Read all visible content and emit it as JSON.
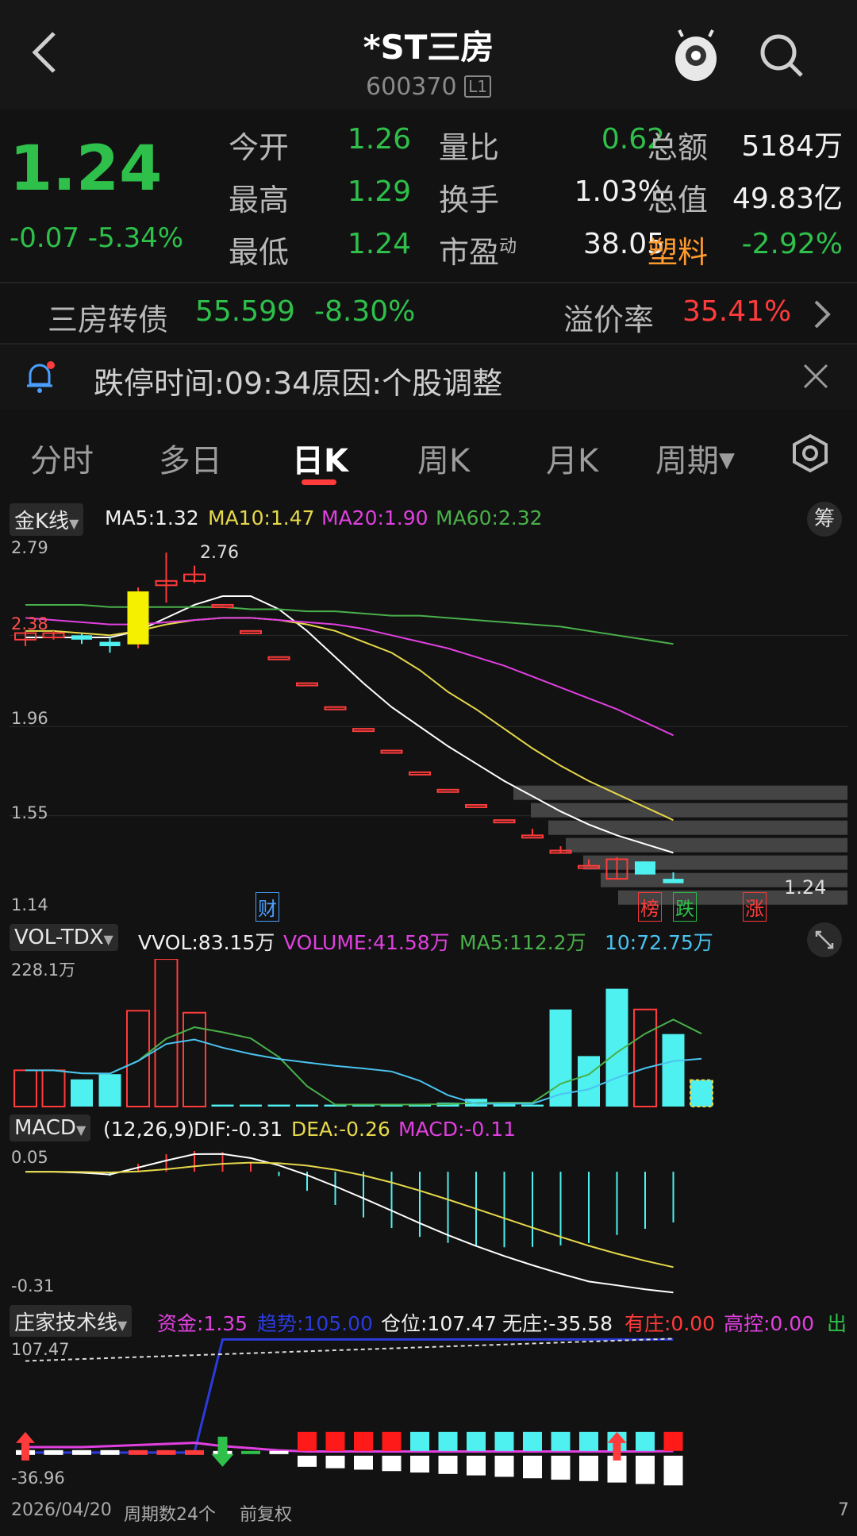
{
  "header": {
    "title": "*ST三房",
    "code": "600370",
    "level_badge": "L1"
  },
  "quote": {
    "price": "1.24",
    "change": "-0.07",
    "change_pct": "-5.34%",
    "stats": [
      {
        "label": "今开",
        "value": "1.26"
      },
      {
        "label": "量比",
        "value": "0.62"
      },
      {
        "label": "总额",
        "value": "5184万"
      },
      {
        "label": "最高",
        "value": "1.29"
      },
      {
        "label": "换手",
        "value": "1.03%"
      },
      {
        "label": "总值",
        "value": "49.83亿"
      },
      {
        "label": "最低",
        "value": "1.24"
      },
      {
        "label": "市盈",
        "sup": "动",
        "value": "38.05"
      },
      {
        "label": "塑料",
        "value": "-2.92%"
      }
    ]
  },
  "bond": {
    "name": "三房转债",
    "price": "55.599",
    "change_pct": "-8.30%",
    "premium_label": "溢价率",
    "premium_value": "35.41%"
  },
  "notice": {
    "text": "跌停时间:09:34原因:个股调整"
  },
  "tabs": {
    "items": [
      "分时",
      "多日",
      "日K",
      "周K",
      "月K",
      "周期"
    ],
    "active": "日K"
  },
  "kline": {
    "selector": "金K线",
    "ma5": "MA5:1.32",
    "ma10": "MA10:1.47",
    "ma20": "MA20:1.90",
    "ma60": "MA60:2.32",
    "chip_btn": "筹",
    "y_labels": [
      "2.79",
      "2.38",
      "1.96",
      "1.55",
      "1.14"
    ],
    "high_label": "2.76",
    "last_label": "1.24",
    "markers": [
      "财",
      "榜",
      "跌",
      "涨"
    ]
  },
  "volume": {
    "selector": "VOL-TDX",
    "vvol": "VVOL:83.15万",
    "volume": "VOLUME:41.58万",
    "ma5": "MA5:112.2万",
    "ma10": "10:72.75万",
    "y_max": "228.1万"
  },
  "macd": {
    "selector": "MACD",
    "params": "(12,26,9)",
    "dif": "DIF:-0.31",
    "dea": "DEA:-0.26",
    "macd": "MACD:-0.11",
    "y_top": "0.05",
    "y_bottom": "-0.31"
  },
  "zhuang": {
    "selector": "庄家技术线",
    "zijin": "资金:1.35",
    "qushi": "趋势:105.00",
    "cangwei": "仓位:107.47",
    "wuzhuang": "无庄:-35.58",
    "youzhuang": "有庄:0.00",
    "gaokong": "高控:0.00",
    "chuhuo": "出货",
    "y_top": "107.47",
    "y_bottom": "-36.96"
  },
  "footer": {
    "date": "2026/04/20",
    "period_count": "周期数24个",
    "adjust": "前复权",
    "edge": "7"
  },
  "chart_data": {
    "type": "candlestick",
    "ylim": [
      1.14,
      2.79
    ],
    "candles": [
      {
        "o": 2.36,
        "c": 2.39,
        "h": 2.4,
        "l": 2.33
      },
      {
        "o": 2.37,
        "c": 2.39,
        "h": 2.4,
        "l": 2.36
      },
      {
        "o": 2.38,
        "c": 2.36,
        "h": 2.39,
        "l": 2.34
      },
      {
        "o": 2.35,
        "c": 2.33,
        "h": 2.37,
        "l": 2.3
      },
      {
        "o": 2.34,
        "c": 2.58,
        "h": 2.6,
        "l": 2.32
      },
      {
        "o": 2.61,
        "c": 2.63,
        "h": 2.76,
        "l": 2.53
      },
      {
        "o": 2.63,
        "c": 2.66,
        "h": 2.7,
        "l": 2.62
      },
      {
        "o": 2.52,
        "c": 2.52,
        "h": 2.52,
        "l": 2.52
      },
      {
        "o": 2.4,
        "c": 2.4,
        "h": 2.4,
        "l": 2.4
      },
      {
        "o": 2.28,
        "c": 2.28,
        "h": 2.28,
        "l": 2.28
      },
      {
        "o": 2.16,
        "c": 2.16,
        "h": 2.16,
        "l": 2.16
      },
      {
        "o": 2.05,
        "c": 2.05,
        "h": 2.05,
        "l": 2.05
      },
      {
        "o": 1.95,
        "c": 1.95,
        "h": 1.95,
        "l": 1.95
      },
      {
        "o": 1.85,
        "c": 1.85,
        "h": 1.85,
        "l": 1.85
      },
      {
        "o": 1.75,
        "c": 1.75,
        "h": 1.75,
        "l": 1.75
      },
      {
        "o": 1.67,
        "c": 1.67,
        "h": 1.67,
        "l": 1.67
      },
      {
        "o": 1.6,
        "c": 1.6,
        "h": 1.6,
        "l": 1.6
      },
      {
        "o": 1.53,
        "c": 1.53,
        "h": 1.53,
        "l": 1.53
      },
      {
        "o": 1.46,
        "c": 1.46,
        "h": 1.49,
        "l": 1.46
      },
      {
        "o": 1.39,
        "c": 1.39,
        "h": 1.41,
        "l": 1.38
      },
      {
        "o": 1.32,
        "c": 1.32,
        "h": 1.35,
        "l": 1.32
      },
      {
        "o": 1.26,
        "c": 1.35,
        "h": 1.36,
        "l": 1.26
      },
      {
        "o": 1.34,
        "c": 1.28,
        "h": 1.34,
        "l": 1.28
      },
      {
        "o": 1.26,
        "c": 1.24,
        "h": 1.29,
        "l": 1.24
      }
    ],
    "ma_lines": [
      {
        "name": "MA5",
        "color": "#ffffff",
        "values": [
          2.37,
          2.37,
          2.37,
          2.37,
          2.4,
          2.46,
          2.52,
          2.56,
          2.56,
          2.5,
          2.4,
          2.28,
          2.16,
          2.05,
          1.96,
          1.87,
          1.79,
          1.71,
          1.64,
          1.57,
          1.51,
          1.46,
          1.42,
          1.38
        ]
      },
      {
        "name": "MA10",
        "color": "#e6d84a",
        "values": [
          2.4,
          2.4,
          2.39,
          2.38,
          2.4,
          2.43,
          2.45,
          2.46,
          2.46,
          2.45,
          2.43,
          2.4,
          2.35,
          2.3,
          2.22,
          2.12,
          2.04,
          1.95,
          1.86,
          1.78,
          1.71,
          1.65,
          1.59,
          1.53
        ]
      },
      {
        "name": "MA20",
        "color": "#e040e0",
        "values": [
          2.46,
          2.45,
          2.44,
          2.43,
          2.43,
          2.44,
          2.45,
          2.46,
          2.46,
          2.45,
          2.44,
          2.43,
          2.41,
          2.38,
          2.35,
          2.32,
          2.28,
          2.24,
          2.19,
          2.14,
          2.09,
          2.04,
          1.98,
          1.92
        ]
      },
      {
        "name": "MA60",
        "color": "#49b04a",
        "values": [
          2.52,
          2.52,
          2.52,
          2.51,
          2.51,
          2.51,
          2.51,
          2.51,
          2.5,
          2.5,
          2.49,
          2.49,
          2.48,
          2.47,
          2.47,
          2.46,
          2.45,
          2.44,
          2.43,
          2.42,
          2.4,
          2.38,
          2.36,
          2.34
        ]
      }
    ],
    "volume": {
      "ylim": [
        0,
        228.1
      ],
      "values": [
        56,
        56,
        42,
        50,
        148,
        228,
        145,
        3,
        3,
        3,
        3,
        3,
        3,
        3,
        4,
        6,
        12,
        5,
        3,
        150,
        78,
        182,
        150,
        112,
        41
      ],
      "up": [
        true,
        true,
        false,
        false,
        true,
        true,
        true,
        false,
        false,
        false,
        false,
        false,
        false,
        false,
        false,
        false,
        false,
        false,
        false,
        false,
        false,
        false,
        true,
        false,
        false
      ]
    }
  }
}
